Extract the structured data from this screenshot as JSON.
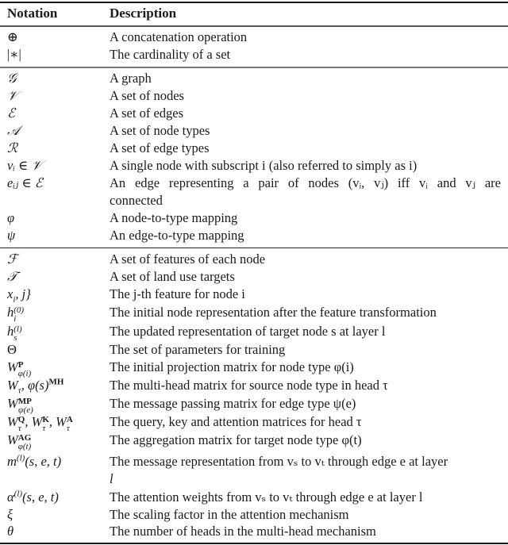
{
  "header": {
    "notation": "Notation",
    "description": "Description"
  },
  "groups": [
    {
      "rows": [
        {
          "notation": "⊕",
          "description": "A concatenation operation"
        },
        {
          "notation": "|∗|",
          "description": "The cardinality of a set"
        }
      ]
    },
    {
      "rows": [
        {
          "notation": "𝒢",
          "description": "A graph"
        },
        {
          "notation": "𝒱",
          "description": "A set of nodes"
        },
        {
          "notation": "ℰ",
          "description": "A set of edges"
        },
        {
          "notation": "𝒜",
          "description": "A set of node types"
        },
        {
          "notation": "ℛ",
          "description": "A set of edge types"
        },
        {
          "notation": "vᵢ ∈ 𝒱",
          "description": "A single node with subscript i (also referred to simply as i)"
        },
        {
          "notation": "eᵢⱼ ∈ ℰ",
          "description": "An edge representing a pair of nodes (vᵢ, vⱼ) iff vᵢ and vⱼ are",
          "description_cont": "connected"
        },
        {
          "notation": "φ",
          "description": "A node-to-type mapping"
        },
        {
          "notation": "ψ",
          "description": "An edge-to-type mapping"
        }
      ]
    },
    {
      "rows": [
        {
          "notation": "ℱ",
          "description": "A set of features of each node"
        },
        {
          "notation": "𝒯",
          "description": "A set of land use targets"
        },
        {
          "notation": "x_{i,j}",
          "description": "The j-th feature for node i"
        },
        {
          "notation": "h_i^(0)",
          "description": "The initial node representation after the feature transformation"
        },
        {
          "notation": "h_s^(l)",
          "description": "The updated representation of target node s at layer l"
        },
        {
          "notation": "Θ",
          "description": "The set of parameters for training"
        },
        {
          "notation": "W_φ(i)^P",
          "description": "The initial projection matrix for node type φ(i)"
        },
        {
          "notation": "W_τ,φ(s)^MH",
          "description": "The multi-head matrix for source node type in head τ"
        },
        {
          "notation": "W_ψ(e)^MP",
          "description": "The message passing matrix for edge type ψ(e)"
        },
        {
          "notation": "W_τ^Q, W_τ^K, W_τ^A",
          "description": "The query, key and attention matrices for head τ"
        },
        {
          "notation": "W_φ(t)^AG",
          "description": "The aggregation matrix for target node type φ(t)"
        },
        {
          "notation": "m^(l)(s, e, t)",
          "description": "The message representation from vₛ to vₜ through edge e at layer",
          "description_cont": "l"
        },
        {
          "notation": "α^(l)(s, e, t)",
          "description": "The attention weights from vₛ to vₜ through edge e at layer l"
        },
        {
          "notation": "ξ",
          "description": "The scaling factor in the attention mechanism"
        },
        {
          "notation": "θ",
          "description": "The number of heads in the multi-head mechanism"
        }
      ]
    }
  ]
}
